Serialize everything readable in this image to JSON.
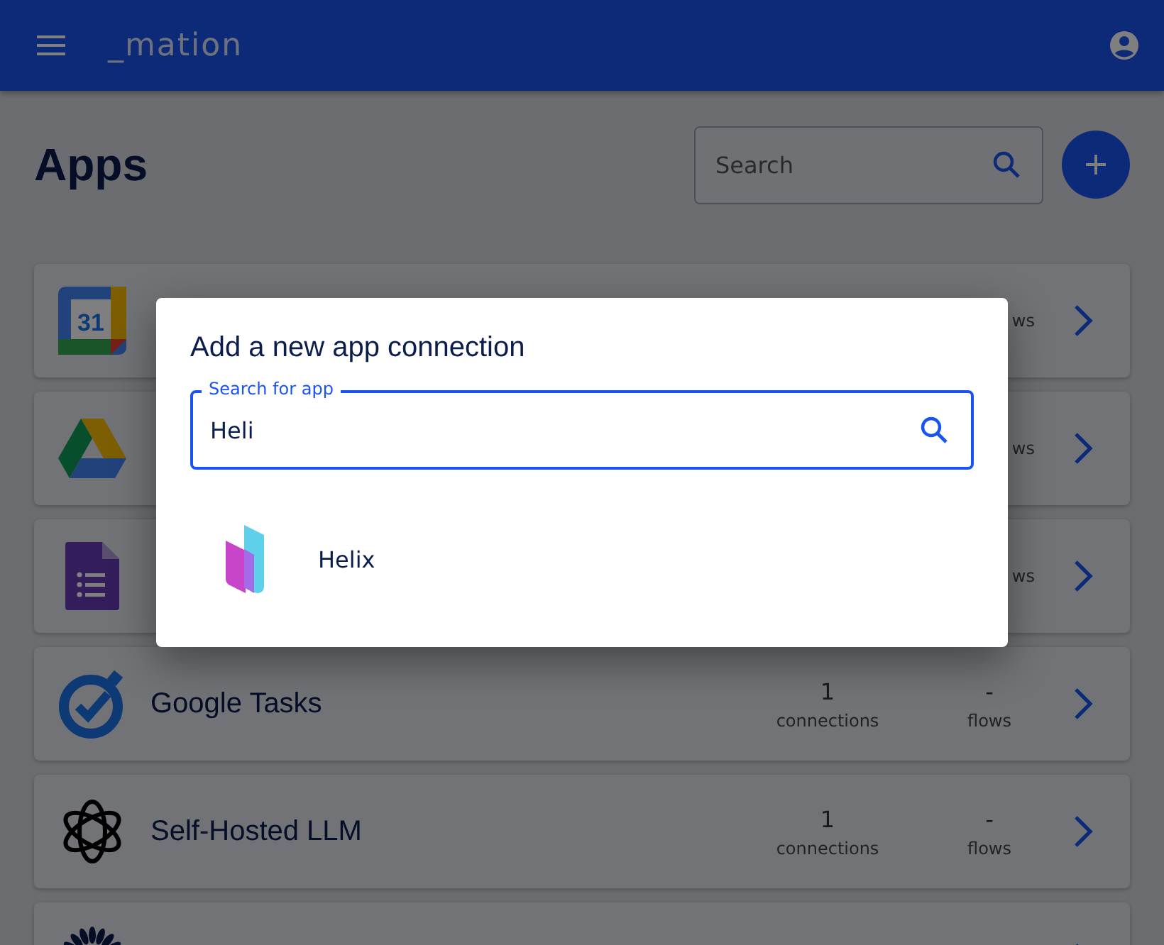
{
  "header": {
    "logo": "_mation"
  },
  "page": {
    "title": "Apps",
    "search": {
      "placeholder": "Search"
    }
  },
  "apps": [
    {
      "kind": "calendar",
      "calendar_day": "31",
      "flows_fragment": "ws"
    },
    {
      "kind": "drive",
      "flows_fragment": "ws"
    },
    {
      "kind": "forms",
      "flows_fragment": "ws"
    },
    {
      "kind": "tasks",
      "name": "Google Tasks",
      "connections": "1",
      "connections_label": "connections",
      "flows": "-",
      "flows_label": "flows"
    },
    {
      "kind": "knot",
      "name": "Self-Hosted LLM",
      "connections": "1",
      "connections_label": "connections",
      "flows": "-",
      "flows_label": "flows"
    },
    {
      "kind": "flower"
    }
  ],
  "dialog": {
    "title": "Add a new app connection",
    "search": {
      "label": "Search for app",
      "value": "Heli"
    },
    "results": [
      {
        "kind": "helix",
        "name": "Helix"
      }
    ]
  }
}
